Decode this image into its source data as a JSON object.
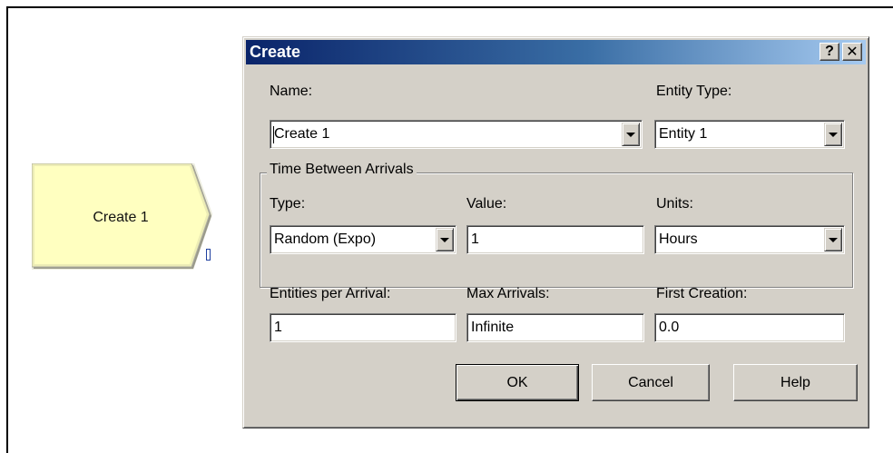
{
  "module": {
    "label": "Create 1"
  },
  "dialog": {
    "title": "Create",
    "help_glyph": "?",
    "close_glyph": "✕",
    "name": {
      "label": "Name:",
      "value": "Create 1"
    },
    "entity_type": {
      "label": "Entity Type:",
      "value": "Entity 1"
    },
    "time_between_arrivals": {
      "legend": "Time Between Arrivals",
      "type": {
        "label": "Type:",
        "value": "Random (Expo)"
      },
      "value": {
        "label": "Value:",
        "value": "1"
      },
      "units": {
        "label": "Units:",
        "value": "Hours"
      }
    },
    "entities_per_arrival": {
      "label": "Entities per Arrival:",
      "value": "1"
    },
    "max_arrivals": {
      "label": "Max Arrivals:",
      "value": "Infinite"
    },
    "first_creation": {
      "label": "First Creation:",
      "value": "0.0"
    },
    "buttons": {
      "ok": "OK",
      "cancel": "Cancel",
      "help": "Help"
    }
  },
  "colors": {
    "title_gradient_start": "#0a246a",
    "title_gradient_end": "#a6caf0",
    "dialog_face": "#d4d0c8",
    "module_fill": "#ffffc0"
  }
}
